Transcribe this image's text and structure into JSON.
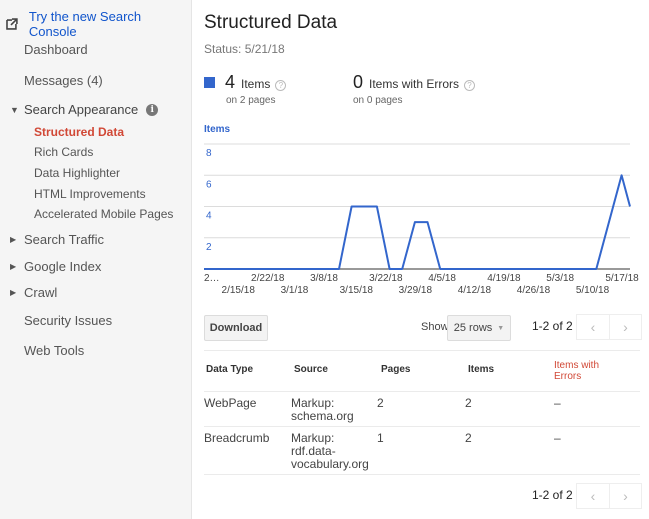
{
  "sidebar": {
    "try_new": "Try the new Search Console",
    "items": [
      {
        "label": "Dashboard"
      },
      {
        "label": "Messages (4)"
      }
    ],
    "search_appearance": {
      "label": "Search Appearance",
      "children": [
        {
          "label": "Structured Data",
          "active": true
        },
        {
          "label": "Rich Cards"
        },
        {
          "label": "Data Highlighter"
        },
        {
          "label": "HTML Improvements"
        },
        {
          "label": "Accelerated Mobile Pages"
        }
      ]
    },
    "sections": [
      {
        "label": "Search Traffic"
      },
      {
        "label": "Google Index"
      },
      {
        "label": "Crawl"
      }
    ],
    "bottom": [
      {
        "label": "Security Issues"
      },
      {
        "label": "Web Tools"
      }
    ]
  },
  "header": {
    "title": "Structured Data",
    "status": "Status: 5/21/18"
  },
  "stats": {
    "items": {
      "count": "4",
      "label": "Items",
      "sub": "on 2 pages",
      "color": "#3366cc"
    },
    "errors": {
      "count": "0",
      "label": "Items with Errors",
      "sub": "on 0 pages"
    }
  },
  "chart_data": {
    "type": "line",
    "title": "",
    "legend": [
      "Items"
    ],
    "legend_position": "top-left",
    "xlabel": "",
    "ylabel": "",
    "ylim": [
      0,
      8
    ],
    "yticks": [
      "2",
      "4",
      "6",
      "8"
    ],
    "grid": true,
    "xtick_labels_row1": [
      "2…",
      "2/22/18",
      "3/8/18",
      "3/22/18",
      "4/5/18",
      "4/19/18",
      "5/3/18",
      "5/17/18"
    ],
    "xtick_labels_row2": [
      "2/15/18",
      "3/1/18",
      "3/15/18",
      "3/29/18",
      "4/12/18",
      "4/26/18",
      "5/10/18"
    ],
    "series": [
      {
        "name": "Items",
        "color": "#3366cc",
        "x_start": "2/8/18",
        "x_end": "5/20/18",
        "points": [
          {
            "date": "2/8/18",
            "value": 0
          },
          {
            "date": "3/12/18",
            "value": 0
          },
          {
            "date": "3/15/18",
            "value": 4
          },
          {
            "date": "3/21/18",
            "value": 4
          },
          {
            "date": "3/24/18",
            "value": 0
          },
          {
            "date": "3/27/18",
            "value": 0
          },
          {
            "date": "3/30/18",
            "value": 3
          },
          {
            "date": "4/2/18",
            "value": 3
          },
          {
            "date": "4/5/18",
            "value": 0
          },
          {
            "date": "5/12/18",
            "value": 0
          },
          {
            "date": "5/18/18",
            "value": 6
          },
          {
            "date": "5/20/18",
            "value": 4
          }
        ]
      }
    ]
  },
  "toolbar": {
    "download": "Download",
    "show": "Show",
    "rows": "25 rows",
    "pager_text": "1-2 of 2",
    "prev": "‹",
    "next": "›"
  },
  "table": {
    "headers": [
      "Data Type",
      "Source",
      "Pages",
      "Items",
      "Items with Errors"
    ],
    "rows": [
      {
        "type": "WebPage",
        "source": "Markup: schema.org",
        "pages": "2",
        "items": "2",
        "errors": "–"
      },
      {
        "type": "Breadcrumb",
        "source": "Markup: rdf.data-vocabulary.org",
        "pages": "1",
        "items": "2",
        "errors": "–"
      }
    ]
  }
}
